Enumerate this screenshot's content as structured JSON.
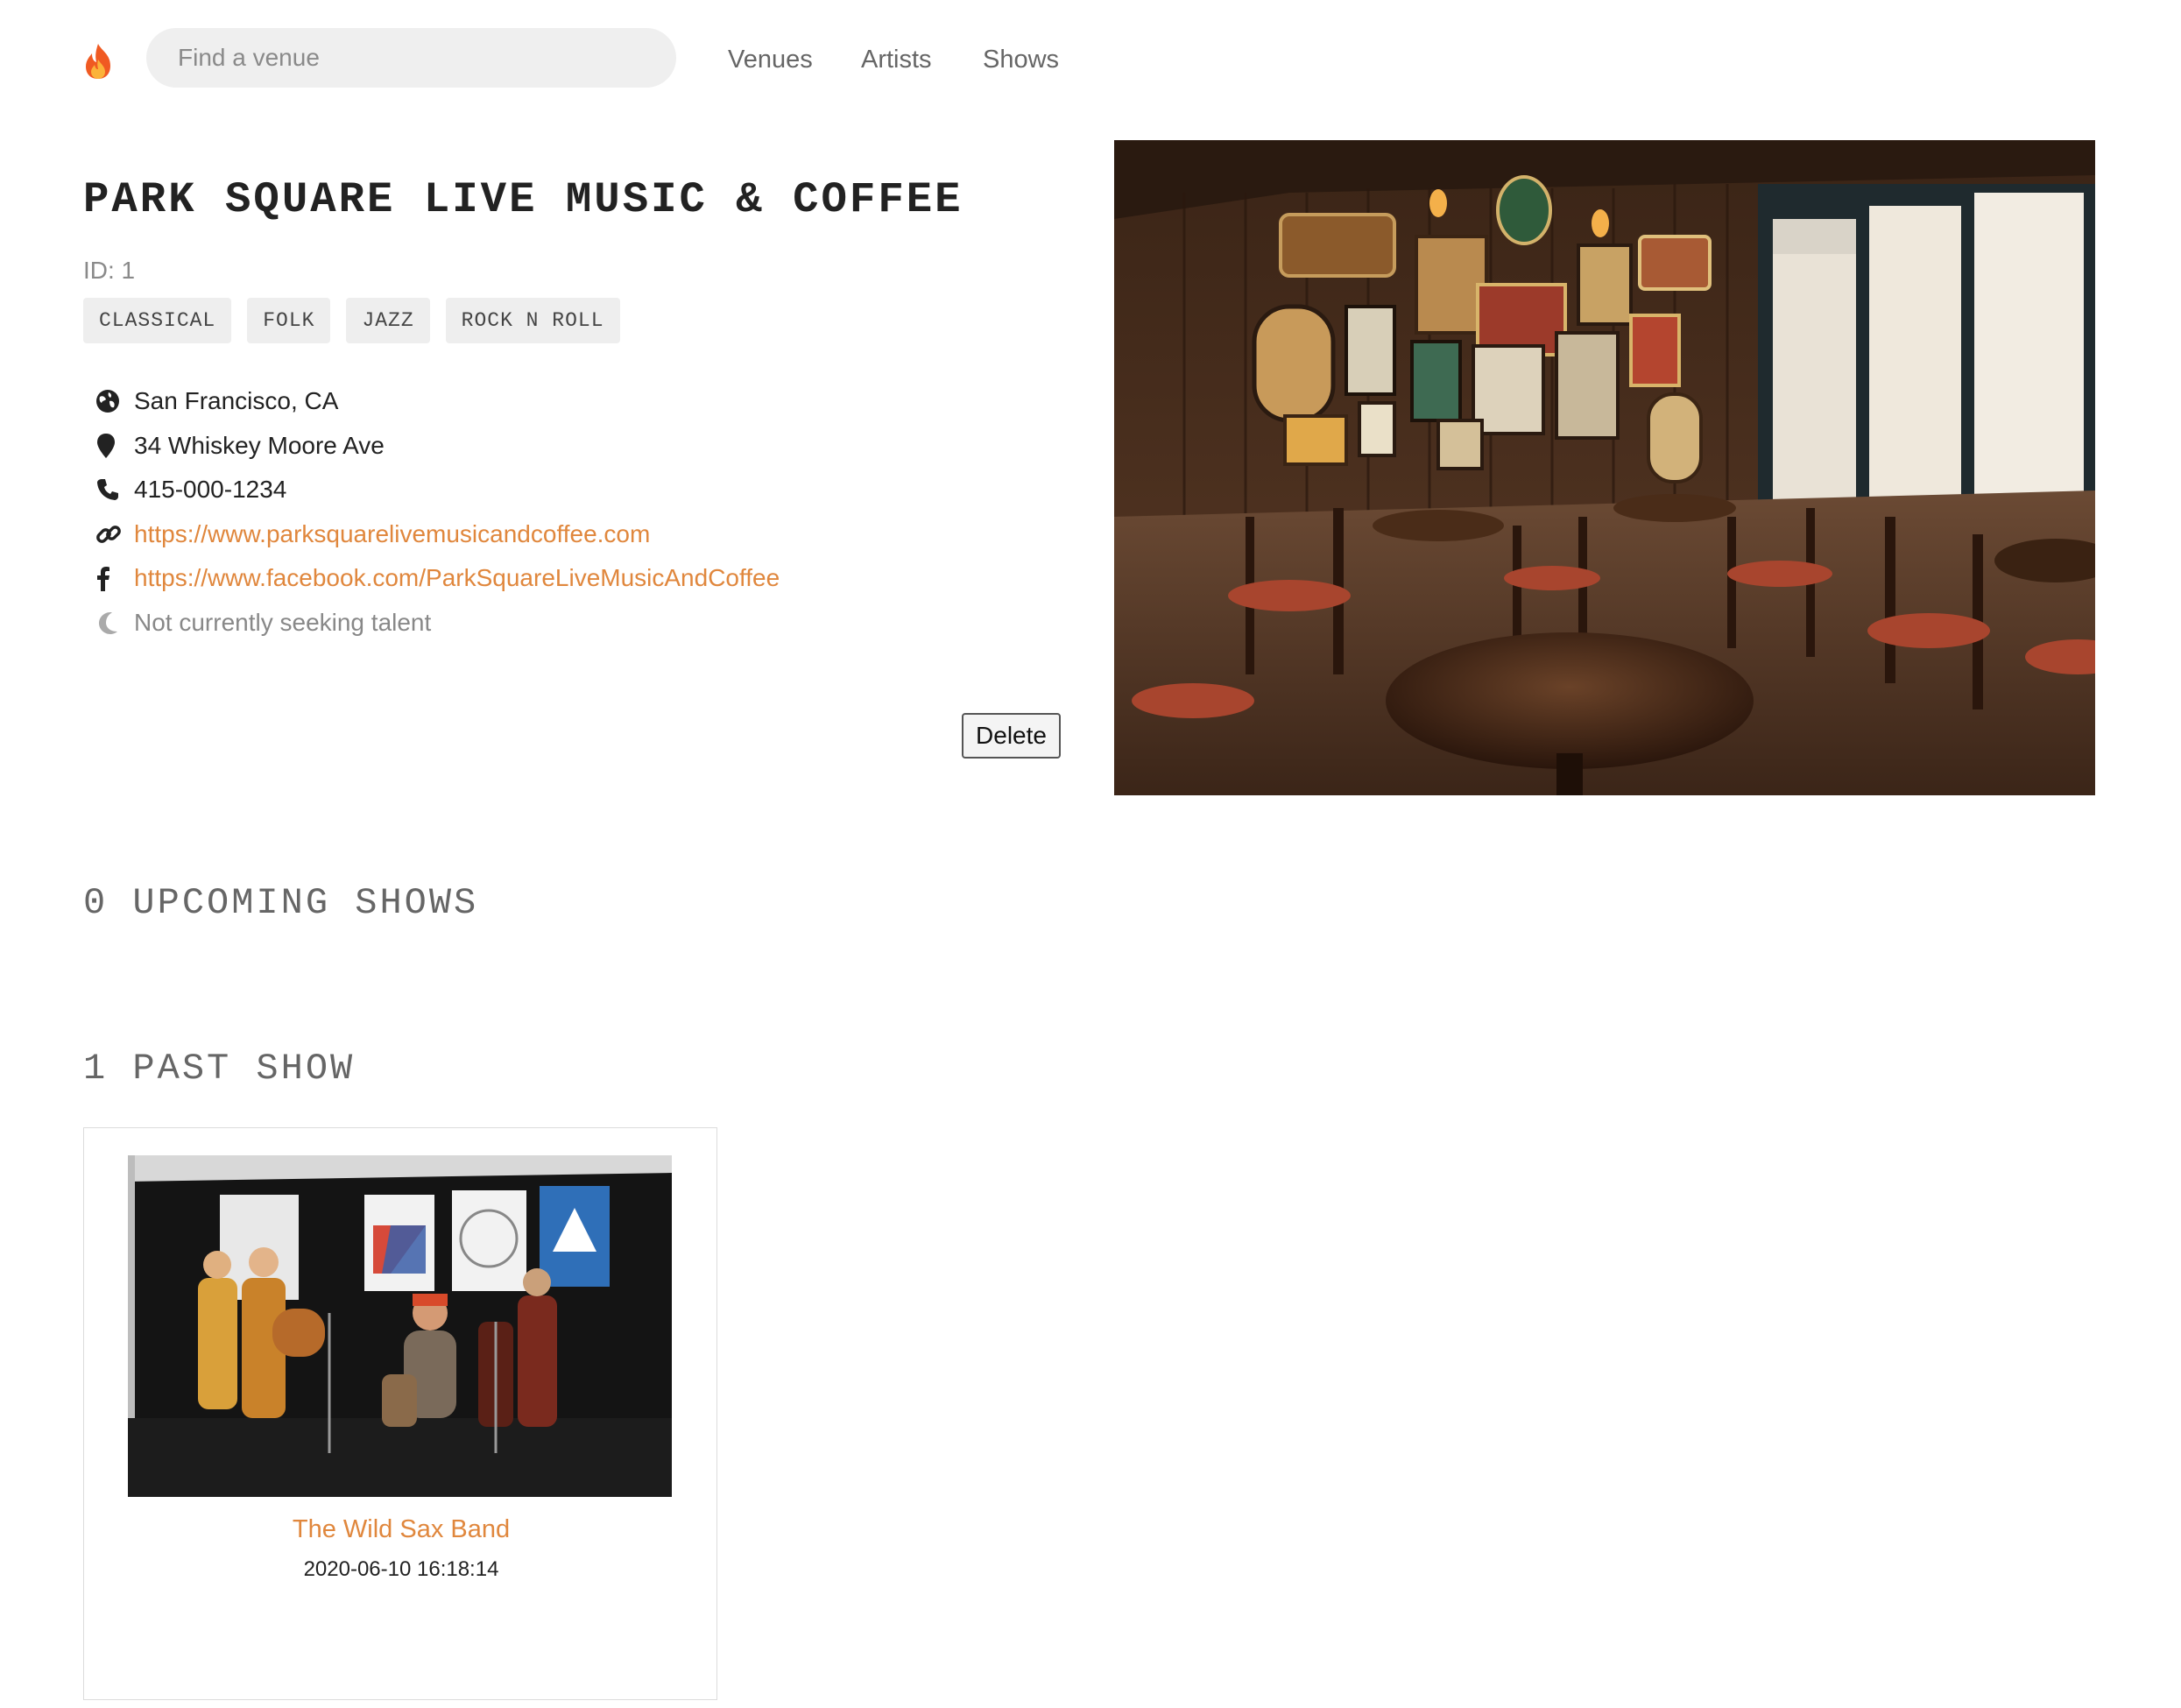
{
  "nav": {
    "logo_glyph": "🔥",
    "search_placeholder": "Find a venue",
    "links": [
      "Venues",
      "Artists",
      "Shows"
    ]
  },
  "venue": {
    "name": "PARK SQUARE LIVE MUSIC & COFFEE",
    "id_label": "ID: 1",
    "genres": [
      "CLASSICAL",
      "FOLK",
      "JAZZ",
      "ROCK N ROLL"
    ],
    "city": "San Francisco, CA",
    "address": "34 Whiskey Moore Ave",
    "phone": "415-000-1234",
    "website": "https://www.parksquarelivemusicandcoffee.com",
    "facebook": "https://www.facebook.com/ParkSquareLiveMusicAndCoffee",
    "seeking": "Not currently seeking talent",
    "delete_label": "Delete"
  },
  "upcoming": {
    "heading": "0 UPCOMING SHOWS"
  },
  "past": {
    "heading": "1 PAST SHOW",
    "shows": [
      {
        "artist": "The Wild Sax Band",
        "start_time": "2020-06-10 16:18:14"
      }
    ]
  },
  "colors": {
    "accent": "#e0873d",
    "muted": "#888888",
    "tag_bg": "#eeeeee"
  },
  "icons": [
    "globe-icon",
    "map-marker-icon",
    "phone-icon",
    "link-icon",
    "facebook-icon",
    "moon-icon"
  ]
}
